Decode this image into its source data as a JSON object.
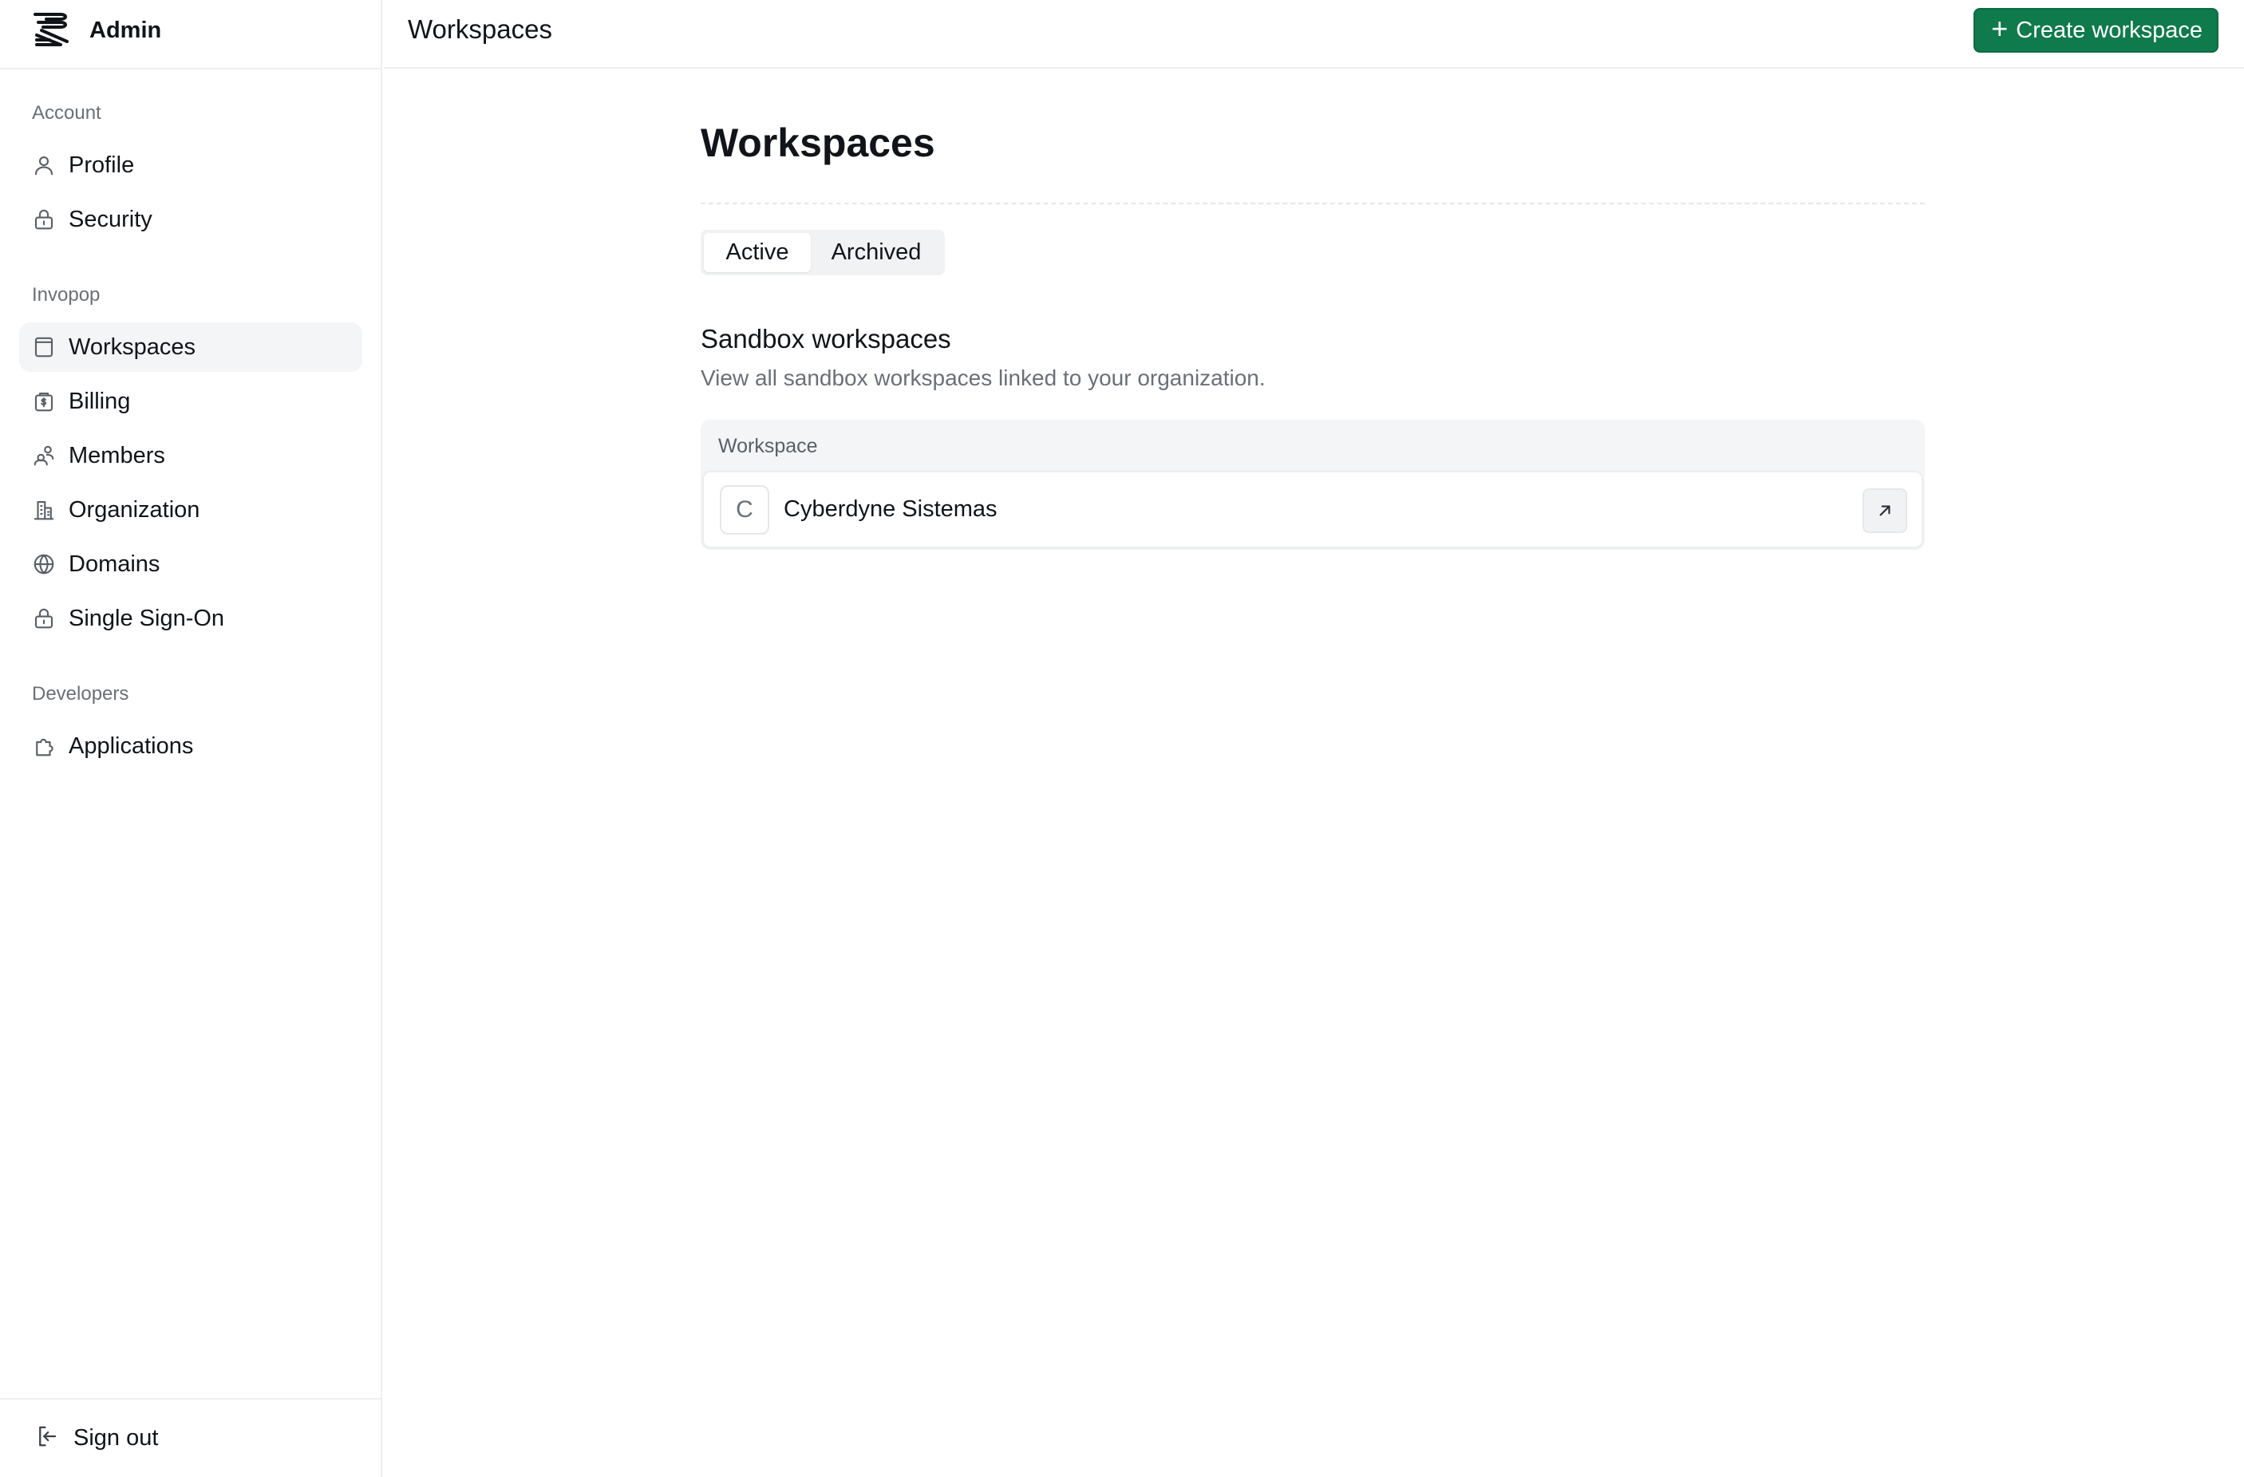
{
  "app": {
    "brand_name": "Admin",
    "logo_icon": "stacked-lines-logo"
  },
  "header": {
    "title": "Workspaces",
    "create_button_label": "Create workspace",
    "create_button_icon": "plus-icon",
    "accent_color": "#0f7a4b"
  },
  "sidebar": {
    "sections": [
      {
        "title": "Account",
        "items": [
          {
            "label": "Profile",
            "icon": "user-icon"
          },
          {
            "label": "Security",
            "icon": "lock-icon"
          }
        ]
      },
      {
        "title": "Invopop",
        "items": [
          {
            "label": "Workspaces",
            "icon": "workspace-icon",
            "active": true
          },
          {
            "label": "Billing",
            "icon": "billing-icon"
          },
          {
            "label": "Members",
            "icon": "members-icon"
          },
          {
            "label": "Organization",
            "icon": "building-icon"
          },
          {
            "label": "Domains",
            "icon": "globe-icon"
          },
          {
            "label": "Single Sign-On",
            "icon": "lock-icon"
          }
        ]
      },
      {
        "title": "Developers",
        "items": [
          {
            "label": "Applications",
            "icon": "puzzle-icon"
          }
        ]
      }
    ],
    "footer": {
      "label": "Sign out",
      "icon": "sign-out-icon"
    }
  },
  "main": {
    "title": "Workspaces",
    "tabs": [
      {
        "label": "Active",
        "active": true
      },
      {
        "label": "Archived",
        "active": false
      }
    ],
    "section": {
      "heading": "Sandbox workspaces",
      "description": "View all sandbox workspaces linked to your organization."
    },
    "table": {
      "column_header": "Workspace",
      "rows": [
        {
          "initial": "C",
          "name": "Cyberdyne Sistemas",
          "action_icon": "arrow-up-right-icon"
        }
      ]
    }
  }
}
